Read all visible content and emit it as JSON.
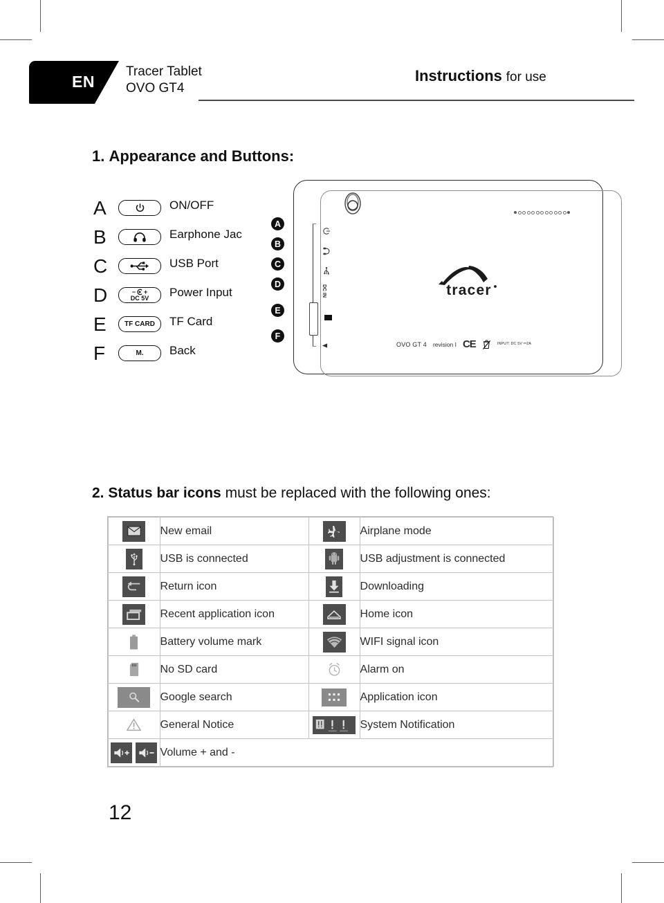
{
  "page": {
    "number": "12",
    "language_tag": "EN"
  },
  "header": {
    "product_line1": "Tracer Tablet",
    "product_line2": "OVO GT4",
    "title_bold": "Instructions",
    "title_rest": "for use"
  },
  "sections": {
    "one": {
      "number": "1.",
      "title": "Appearance and Buttons:"
    },
    "two": {
      "number": "2.",
      "title": "Status bar icons",
      "rest": "must be replaced with the following ones:"
    }
  },
  "legend": [
    {
      "letter": "A",
      "icon": "power-icon",
      "pill_text": "",
      "label": "ON/OFF"
    },
    {
      "letter": "B",
      "icon": "headphone-icon",
      "pill_text": "",
      "label": "Earphone Jac"
    },
    {
      "letter": "C",
      "icon": "usb-icon",
      "pill_text": "",
      "label": "USB Port"
    },
    {
      "letter": "D",
      "icon": "dc-jack-icon",
      "pill_text": "DC 5V",
      "label": "Power Input"
    },
    {
      "letter": "E",
      "icon": "tf-card-icon",
      "pill_text": "TF CARD",
      "label": "TF Card"
    },
    {
      "letter": "F",
      "icon": "back-icon",
      "pill_text": "M.",
      "label": "Back"
    }
  ],
  "device": {
    "badges": [
      "A",
      "B",
      "C",
      "D",
      "E",
      "F"
    ],
    "port_labels": [
      "",
      "",
      "",
      "DC IN",
      "",
      ""
    ],
    "brand": "tracer",
    "model": "OVO GT 4",
    "revision": "revision I",
    "ce_mark": "CE",
    "input_rating": "INPUT: DC 5V ⎓2A"
  },
  "icon_table": {
    "rows": [
      {
        "left_icon": "email-icon",
        "left_label": "New email",
        "right_icon": "airplane-icon",
        "right_label": "Airplane mode"
      },
      {
        "left_icon": "usb-icon",
        "left_label": "USB is connected",
        "right_icon": "android-icon",
        "right_label": "USB adjustment is connected"
      },
      {
        "left_icon": "return-icon",
        "left_label": "Return icon",
        "right_icon": "download-icon",
        "right_label": "Downloading"
      },
      {
        "left_icon": "recent-apps-icon",
        "left_label": "Recent application icon",
        "right_icon": "home-icon",
        "right_label": "Home icon"
      },
      {
        "left_icon": "battery-icon",
        "left_label": "Battery volume mark",
        "right_icon": "wifi-icon",
        "right_label": "WIFI signal icon"
      },
      {
        "left_icon": "no-sd-card-icon",
        "left_label": "No SD card",
        "right_icon": "alarm-icon",
        "right_label": "Alarm on"
      },
      {
        "left_icon": "search-icon",
        "left_label": "Google search",
        "right_icon": "apps-grid-icon",
        "right_label": "Application icon"
      },
      {
        "left_icon": "warning-icon",
        "left_label": "General Notice",
        "right_icon": "notification-icon",
        "right_label": "System Notification"
      }
    ],
    "last_row": {
      "icon": "volume-updown-icon",
      "label": "Volume + and -"
    }
  },
  "colors": {
    "ink": "#111111",
    "tag_bg": "#000000",
    "rule": "#4a4a4a",
    "table_border": "#c2c2c2",
    "icon_dark": "#4d4d4d",
    "icon_light": "#8a8a8a"
  }
}
